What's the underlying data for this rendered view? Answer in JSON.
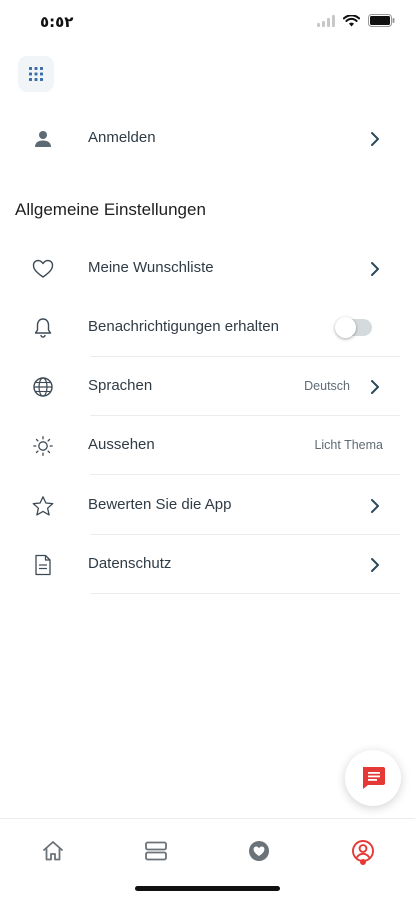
{
  "status_bar": {
    "time": "٥:٥٢"
  },
  "account": {
    "login_label": "Anmelden"
  },
  "general_settings": {
    "title": "Allgemeine Einstellungen",
    "items": [
      {
        "label": "Meine Wunschliste",
        "icon": "heart-icon"
      },
      {
        "label": "Benachrichtigungen erhalten",
        "icon": "bell-icon",
        "toggle_on": false
      },
      {
        "label": "Sprachen",
        "icon": "globe-icon",
        "value": "Deutsch"
      },
      {
        "label": "Aussehen",
        "icon": "sun-icon",
        "value": "Licht Thema"
      },
      {
        "label": "Bewerten Sie die App",
        "icon": "star-icon"
      },
      {
        "label": "Datenschutz",
        "icon": "document-icon"
      }
    ]
  },
  "bottom_nav": {
    "items": [
      "home-icon",
      "layers-icon",
      "heart-filled-icon",
      "profile-icon"
    ],
    "active": "profile-icon"
  },
  "colors": {
    "accent": "#e53935",
    "icon": "#3d4a55",
    "chevron": "#2c4a5c"
  }
}
